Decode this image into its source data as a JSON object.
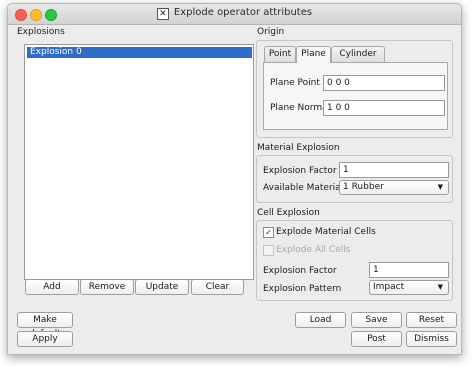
{
  "window": {
    "title": "Explode operator attributes",
    "app_icon": "x-window-icon"
  },
  "explosions": {
    "label": "Explosions",
    "items": [
      "Explosion 0"
    ],
    "selected_index": 0,
    "buttons": {
      "add": "Add",
      "remove": "Remove",
      "update": "Update",
      "clear": "Clear"
    }
  },
  "origin": {
    "label": "Origin",
    "tabs": [
      "Point",
      "Plane",
      "Cylinder"
    ],
    "active_tab": "Plane",
    "plane_point_label": "Plane Point",
    "plane_point_value": "0 0 0",
    "plane_normal_label": "Plane Normal",
    "plane_normal_value": "1 0 0"
  },
  "material_explosion": {
    "label": "Material Explosion",
    "factor_label": "Explosion Factor",
    "factor_value": "1",
    "materials_label": "Available Materials",
    "materials_value": "1 Rubber"
  },
  "cell_explosion": {
    "label": "Cell Explosion",
    "explode_material_cells_label": "Explode Material Cells",
    "explode_material_cells_checked": true,
    "explode_all_cells_label": "Explode All Cells",
    "explode_all_cells_checked": false,
    "factor_label": "Explosion Factor",
    "factor_value": "1",
    "pattern_label": "Explosion Pattern",
    "pattern_value": "Impact"
  },
  "footer": {
    "make_default": "Make default",
    "apply": "Apply",
    "load": "Load",
    "save": "Save",
    "reset": "Reset",
    "post": "Post",
    "dismiss": "Dismiss"
  }
}
